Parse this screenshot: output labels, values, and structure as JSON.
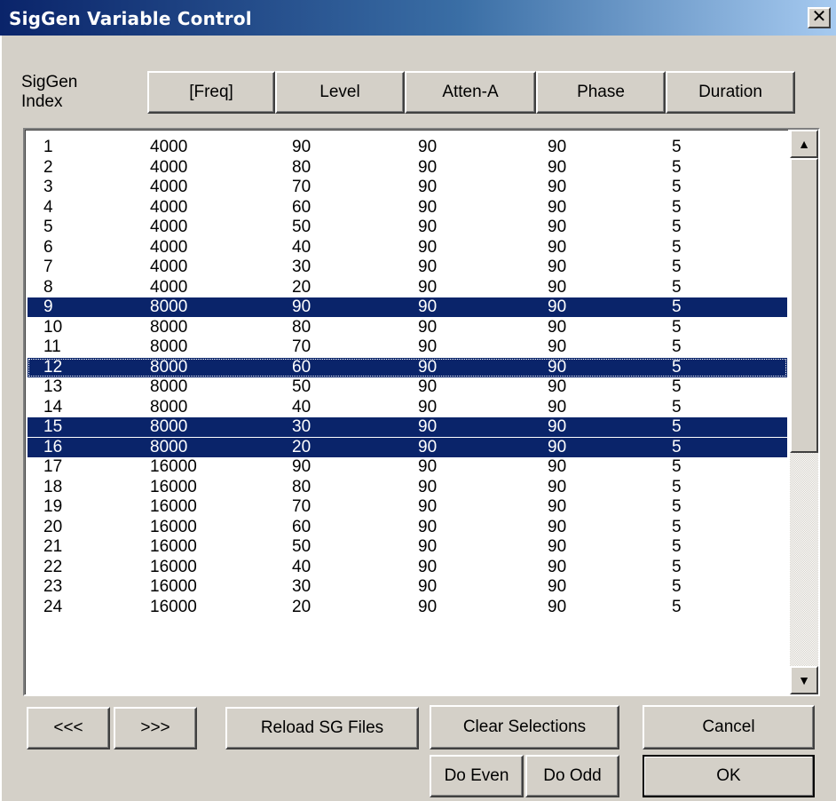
{
  "window": {
    "title": "SigGen Variable Control",
    "close": "✕"
  },
  "header": {
    "index_label_line1": "SigGen",
    "index_label_line2": "Index",
    "columns": [
      "[Freq]",
      "Level",
      "Atten-A",
      "Phase",
      "Duration"
    ]
  },
  "rows": [
    {
      "idx": "1",
      "freq": "4000",
      "level": "90",
      "atten": "90",
      "phase": "90",
      "duration": "5",
      "selected": false
    },
    {
      "idx": "2",
      "freq": "4000",
      "level": "80",
      "atten": "90",
      "phase": "90",
      "duration": "5",
      "selected": false
    },
    {
      "idx": "3",
      "freq": "4000",
      "level": "70",
      "atten": "90",
      "phase": "90",
      "duration": "5",
      "selected": false
    },
    {
      "idx": "4",
      "freq": "4000",
      "level": "60",
      "atten": "90",
      "phase": "90",
      "duration": "5",
      "selected": false
    },
    {
      "idx": "5",
      "freq": "4000",
      "level": "50",
      "atten": "90",
      "phase": "90",
      "duration": "5",
      "selected": false
    },
    {
      "idx": "6",
      "freq": "4000",
      "level": "40",
      "atten": "90",
      "phase": "90",
      "duration": "5",
      "selected": false
    },
    {
      "idx": "7",
      "freq": "4000",
      "level": "30",
      "atten": "90",
      "phase": "90",
      "duration": "5",
      "selected": false
    },
    {
      "idx": "8",
      "freq": "4000",
      "level": "20",
      "atten": "90",
      "phase": "90",
      "duration": "5",
      "selected": false
    },
    {
      "idx": "9",
      "freq": "8000",
      "level": "90",
      "atten": "90",
      "phase": "90",
      "duration": "5",
      "selected": true
    },
    {
      "idx": "10",
      "freq": "8000",
      "level": "80",
      "atten": "90",
      "phase": "90",
      "duration": "5",
      "selected": false
    },
    {
      "idx": "11",
      "freq": "8000",
      "level": "70",
      "atten": "90",
      "phase": "90",
      "duration": "5",
      "selected": false
    },
    {
      "idx": "12",
      "freq": "8000",
      "level": "60",
      "atten": "90",
      "phase": "90",
      "duration": "5",
      "selected": true,
      "focused": true
    },
    {
      "idx": "13",
      "freq": "8000",
      "level": "50",
      "atten": "90",
      "phase": "90",
      "duration": "5",
      "selected": false
    },
    {
      "idx": "14",
      "freq": "8000",
      "level": "40",
      "atten": "90",
      "phase": "90",
      "duration": "5",
      "selected": false
    },
    {
      "idx": "15",
      "freq": "8000",
      "level": "30",
      "atten": "90",
      "phase": "90",
      "duration": "5",
      "selected": true
    },
    {
      "idx": "16",
      "freq": "8000",
      "level": "20",
      "atten": "90",
      "phase": "90",
      "duration": "5",
      "selected": true
    },
    {
      "idx": "17",
      "freq": "16000",
      "level": "90",
      "atten": "90",
      "phase": "90",
      "duration": "5",
      "selected": false
    },
    {
      "idx": "18",
      "freq": "16000",
      "level": "80",
      "atten": "90",
      "phase": "90",
      "duration": "5",
      "selected": false
    },
    {
      "idx": "19",
      "freq": "16000",
      "level": "70",
      "atten": "90",
      "phase": "90",
      "duration": "5",
      "selected": false
    },
    {
      "idx": "20",
      "freq": "16000",
      "level": "60",
      "atten": "90",
      "phase": "90",
      "duration": "5",
      "selected": false
    },
    {
      "idx": "21",
      "freq": "16000",
      "level": "50",
      "atten": "90",
      "phase": "90",
      "duration": "5",
      "selected": false
    },
    {
      "idx": "22",
      "freq": "16000",
      "level": "40",
      "atten": "90",
      "phase": "90",
      "duration": "5",
      "selected": false
    },
    {
      "idx": "23",
      "freq": "16000",
      "level": "30",
      "atten": "90",
      "phase": "90",
      "duration": "5",
      "selected": false
    },
    {
      "idx": "24",
      "freq": "16000",
      "level": "20",
      "atten": "90",
      "phase": "90",
      "duration": "5",
      "selected": false
    }
  ],
  "scrollbar": {
    "up": "▲",
    "down": "▼"
  },
  "buttons": {
    "prev": "<<<",
    "next": ">>>",
    "reload": "Reload SG Files",
    "clear": "Clear Selections",
    "cancel": "Cancel",
    "even": "Do Even",
    "odd": "Do Odd",
    "ok": "OK"
  },
  "colors": {
    "selection": "#0a246a",
    "face": "#d4d0c8",
    "title_start": "#0a246a",
    "title_end": "#a6caf0"
  }
}
